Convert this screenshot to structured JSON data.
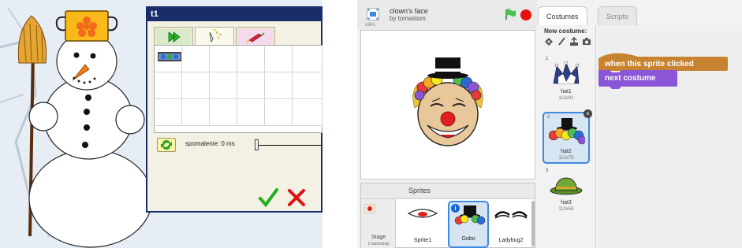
{
  "left_app": {
    "window_title": "t1",
    "tabs": [
      {
        "icon": "run-arrows-icon"
      },
      {
        "icon": "magic-wand-icon"
      },
      {
        "icon": "rocket-icon"
      }
    ],
    "delay_label": "spomalenie: 0 ms",
    "colors": {
      "title_bar": "#1a2d6b",
      "window_bg": "#f3f1e4"
    }
  },
  "scratch": {
    "project_title": "clown's face",
    "author": "by tomastom",
    "version": "v341",
    "tabs": {
      "costumes": "Costumes",
      "scripts": "Scripts"
    },
    "new_costume_label": "New costume:",
    "sprites_header": "Sprites",
    "stage": {
      "label": "Stage",
      "sub": "1 backdrop"
    },
    "sprites": [
      {
        "name": "Sprite1"
      },
      {
        "name": "Gobo"
      },
      {
        "name": "Ladybug2"
      }
    ],
    "costumes": [
      {
        "index": "1",
        "name": "hat1",
        "size": "113x91"
      },
      {
        "index": "2",
        "name": "hat2",
        "size": "112x75"
      },
      {
        "index": "3",
        "name": "hat3",
        "size": "113x58"
      }
    ],
    "blocks": {
      "hat": "when this sprite clicked",
      "looks": "next costume"
    },
    "colors": {
      "events": "#c88330",
      "looks": "#8a55d7",
      "accent": "#3c89e0"
    }
  }
}
